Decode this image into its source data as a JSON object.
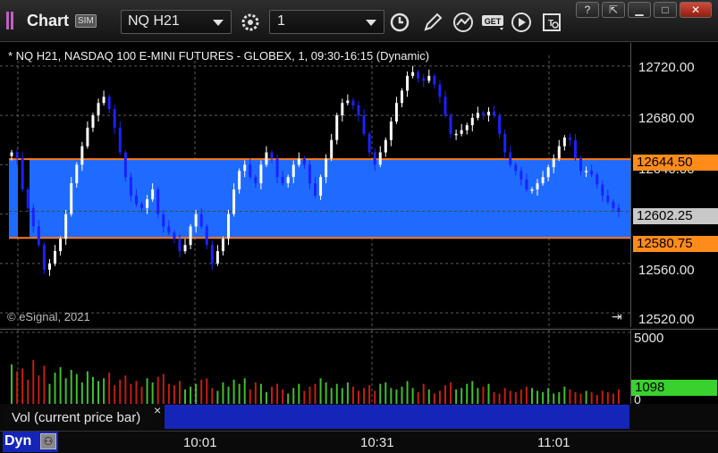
{
  "window": {
    "title": "Chart",
    "sim_badge": "SIM"
  },
  "toolbar": {
    "symbol": "NQ H21",
    "interval": "1"
  },
  "chart": {
    "header": "* NQ H21, NASDAQ 100 E-MINI FUTURES - GLOBEX, 1, 09:30-16:15 (Dynamic)",
    "copyright": "© eSignal, 2021",
    "price_ticks": [
      "12720.00",
      "12680.00",
      "12640.00",
      "12560.00",
      "12520.00"
    ],
    "price_tags": {
      "upper": "12644.50",
      "current": "12602.25",
      "lower": "12580.75"
    },
    "colors": {
      "band": "#1f6bff",
      "upper_line": "#ff7a1a",
      "lower_line": "#ff7a1a",
      "up_bar": "#ffffff",
      "down_bar": "#1a22ff",
      "tag_orange": "#ff8c1a",
      "tag_gray": "#c8c8c8",
      "vol_tag": "#39d12e"
    }
  },
  "volume": {
    "ticks": [
      "5000",
      "0"
    ],
    "current": "1098",
    "study_label": "Vol (current price bar)",
    "close_glyph": "×"
  },
  "time_axis": {
    "labels": [
      "10:01",
      "10:31",
      "11:01"
    ]
  },
  "footer": {
    "mode": "Dyn"
  },
  "chart_data": {
    "type": "candlestick",
    "ylim": [
      12510,
      12730
    ],
    "bands": {
      "upper": 12644.5,
      "lower": 12580.75,
      "current": 12602.25
    },
    "closes": [
      12650,
      12645,
      12620,
      12605,
      12590,
      12575,
      12555,
      12560,
      12570,
      12580,
      12600,
      12625,
      12640,
      12655,
      12670,
      12680,
      12690,
      12695,
      12685,
      12670,
      12650,
      12630,
      12615,
      12608,
      12605,
      12612,
      12620,
      12600,
      12590,
      12585,
      12580,
      12570,
      12575,
      12590,
      12600,
      12590,
      12575,
      12560,
      12570,
      12580,
      12600,
      12620,
      12635,
      12640,
      12630,
      12625,
      12640,
      12650,
      12645,
      12630,
      12625,
      12630,
      12640,
      12645,
      12640,
      12625,
      12615,
      12630,
      12645,
      12660,
      12680,
      12690,
      12692,
      12688,
      12680,
      12665,
      12650,
      12640,
      12650,
      12660,
      12675,
      12690,
      12700,
      12712,
      12715,
      12710,
      12708,
      12712,
      12705,
      12695,
      12680,
      12665,
      12665,
      12668,
      12672,
      12678,
      12682,
      12680,
      12683,
      12680,
      12665,
      12650,
      12640,
      12635,
      12628,
      12620,
      12620,
      12625,
      12630,
      12638,
      12645,
      12655,
      12662,
      12660,
      12645,
      12635,
      12635,
      12632,
      12624,
      12615,
      12610,
      12605,
      12602
    ],
    "volumes": [
      2900,
      2400,
      2600,
      1800,
      3200,
      2100,
      2800,
      1500,
      2300,
      2700,
      1900,
      2500,
      2200,
      1600,
      2400,
      2000,
      1700,
      1900,
      2300,
      1400,
      1800,
      2100,
      1500,
      1700,
      1300,
      1900,
      1600,
      2000,
      2200,
      1500,
      1400,
      1700,
      1100,
      1300,
      1500,
      1800,
      1900,
      1200,
      1000,
      1600,
      1300,
      1800,
      1500,
      1900,
      1100,
      1600,
      1500,
      900,
      1300,
      1500,
      1100,
      800,
      1200,
      1500,
      1000,
      1300,
      1500,
      1900,
      1600,
      1200,
      1500,
      1200,
      1600,
      1300,
      1000,
      1200,
      1400,
      1000,
      1500,
      1600,
      1200,
      1100,
      1300,
      1700,
      1200,
      900,
      1500,
      1100,
      800,
      1000,
      1400,
      1600,
      1100,
      1200,
      1500,
      1700,
      1200,
      1300,
      1500,
      900,
      800,
      1200,
      1000,
      900,
      1100,
      1300,
      1200,
      1000,
      900,
      1200,
      800,
      900,
      1300,
      1100,
      900,
      800,
      1000,
      900,
      700,
      1000,
      900,
      800,
      1098
    ]
  }
}
